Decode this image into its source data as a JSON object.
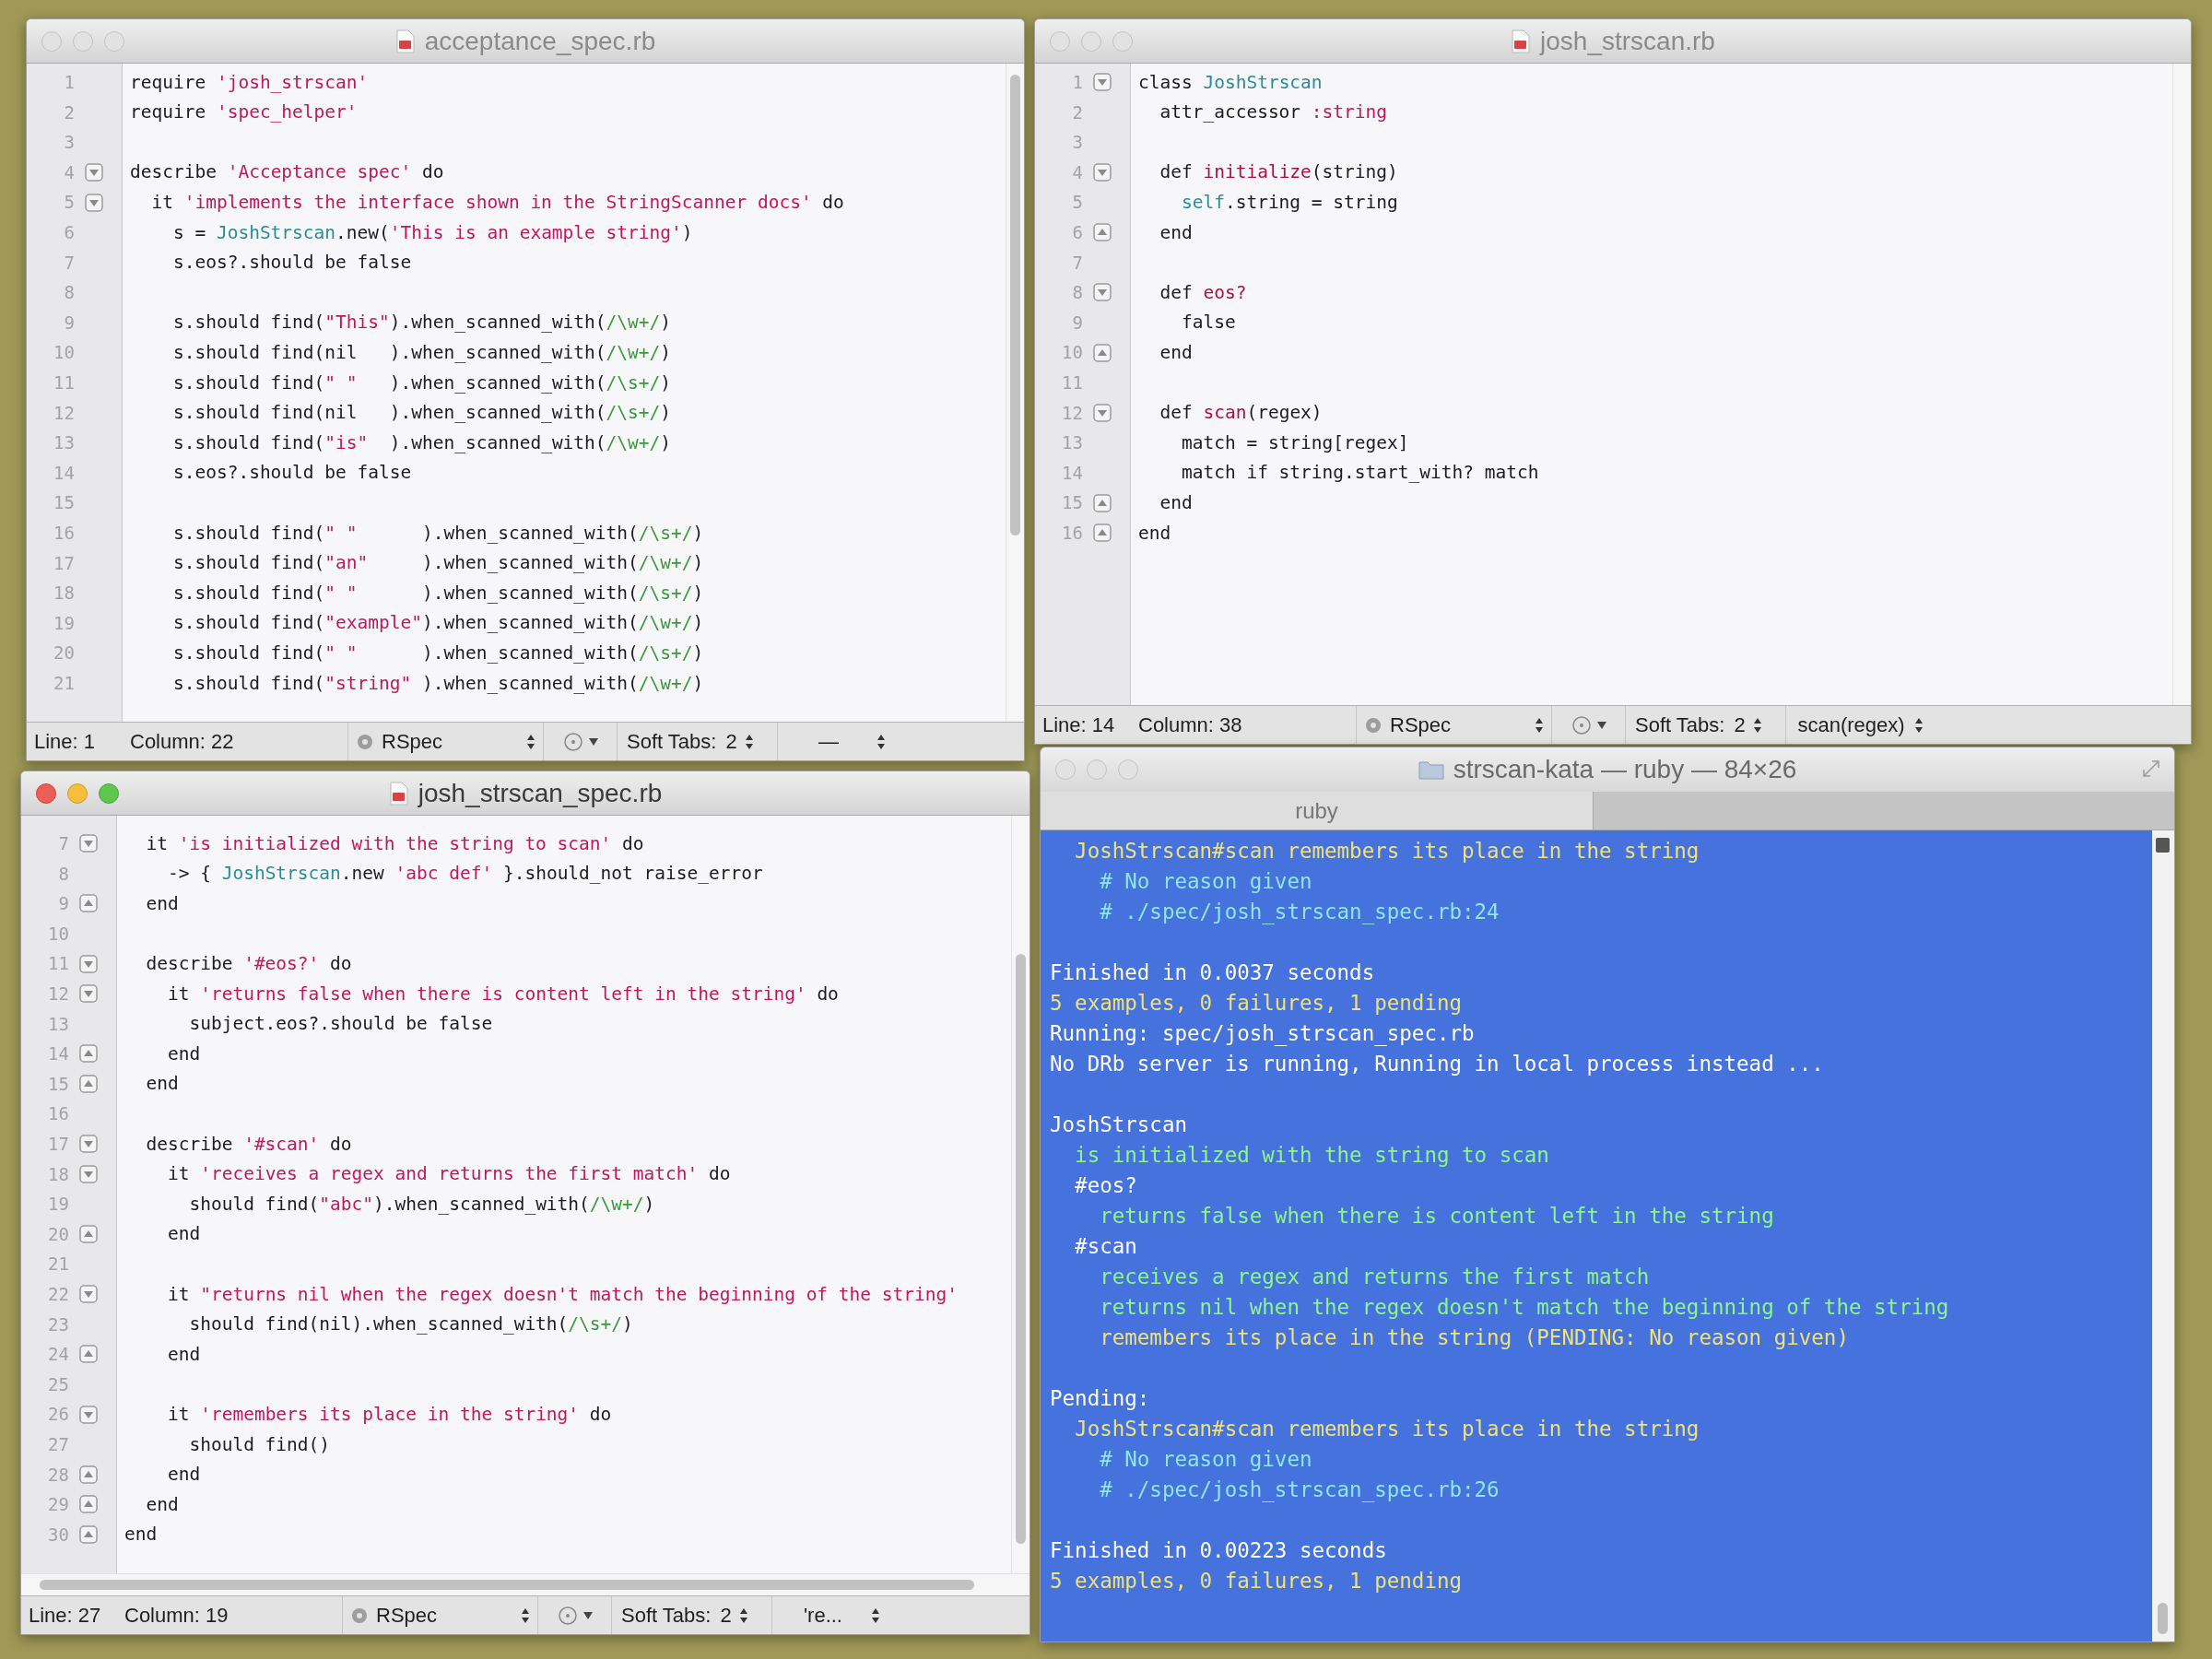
{
  "editors": [
    {
      "title": "acceptance_spec.rb",
      "active": false,
      "lines": [
        {
          "number": "1",
          "kind": "plain",
          "segments": [
            {
              "text": "require ",
              "kind": "plain"
            },
            {
              "text": "'josh_strscan'",
              "kind": "string"
            }
          ]
        },
        {
          "number": "2",
          "kind": "plain",
          "segments": [
            {
              "text": "require ",
              "kind": "plain"
            },
            {
              "text": "'spec_helper'",
              "kind": "string"
            }
          ]
        },
        {
          "number": "3",
          "kind": "plain"
        },
        {
          "number": "4",
          "kind": "opens",
          "segments": [
            {
              "text": "describe ",
              "kind": "plain"
            },
            {
              "text": "'Acceptance spec'",
              "kind": "string"
            },
            {
              "text": " do",
              "kind": "plain"
            }
          ]
        },
        {
          "number": "5",
          "kind": "opens",
          "segments": [
            {
              "text": "  it ",
              "kind": "plain"
            },
            {
              "text": "'implements the interface shown in the StringScanner docs'",
              "kind": "string"
            },
            {
              "text": " do",
              "kind": "plain"
            }
          ]
        },
        {
          "number": "6",
          "kind": "plain",
          "segments": [
            {
              "text": "    s = ",
              "kind": "plain"
            },
            {
              "text": "JoshStrscan",
              "kind": "constant"
            },
            {
              "text": ".new(",
              "kind": "plain"
            },
            {
              "text": "'This is an example string'",
              "kind": "string"
            },
            {
              "text": ")",
              "kind": "plain"
            }
          ]
        },
        {
          "number": "7",
          "kind": "plain",
          "segments": [
            {
              "text": "    s.eos?.should be false",
              "kind": "plain"
            }
          ]
        },
        {
          "number": "8",
          "kind": "plain"
        },
        {
          "number": "9",
          "kind": "plain",
          "segments": [
            {
              "text": "    s.should find(",
              "kind": "plain"
            },
            {
              "text": "\"This\"",
              "kind": "string"
            },
            {
              "text": ").when_scanned_with(",
              "kind": "plain"
            },
            {
              "text": "/\\w+/",
              "kind": "regex"
            },
            {
              "text": ")",
              "kind": "plain"
            }
          ]
        },
        {
          "number": "10",
          "kind": "plain",
          "segments": [
            {
              "text": "    s.should find(nil   ).when_scanned_with(",
              "kind": "plain"
            },
            {
              "text": "/\\w+/",
              "kind": "regex"
            },
            {
              "text": ")",
              "kind": "plain"
            }
          ]
        },
        {
          "number": "11",
          "kind": "plain",
          "segments": [
            {
              "text": "    s.should find(",
              "kind": "plain"
            },
            {
              "text": "\" \"",
              "kind": "string"
            },
            {
              "text": "   ).when_scanned_with(",
              "kind": "plain"
            },
            {
              "text": "/\\s+/",
              "kind": "regex"
            },
            {
              "text": ")",
              "kind": "plain"
            }
          ]
        },
        {
          "number": "12",
          "kind": "plain",
          "segments": [
            {
              "text": "    s.should find(nil   ).when_scanned_with(",
              "kind": "plain"
            },
            {
              "text": "/\\s+/",
              "kind": "regex"
            },
            {
              "text": ")",
              "kind": "plain"
            }
          ]
        },
        {
          "number": "13",
          "kind": "plain",
          "segments": [
            {
              "text": "    s.should find(",
              "kind": "plain"
            },
            {
              "text": "\"is\"",
              "kind": "string"
            },
            {
              "text": "  ).when_scanned_with(",
              "kind": "plain"
            },
            {
              "text": "/\\w+/",
              "kind": "regex"
            },
            {
              "text": ")",
              "kind": "plain"
            }
          ]
        },
        {
          "number": "14",
          "kind": "plain",
          "segments": [
            {
              "text": "    s.eos?.should be false",
              "kind": "plain"
            }
          ]
        },
        {
          "number": "15",
          "kind": "plain"
        },
        {
          "number": "16",
          "kind": "plain",
          "segments": [
            {
              "text": "    s.should find(",
              "kind": "plain"
            },
            {
              "text": "\" \"",
              "kind": "string"
            },
            {
              "text": "      ).when_scanned_with(",
              "kind": "plain"
            },
            {
              "text": "/\\s+/",
              "kind": "regex"
            },
            {
              "text": ")",
              "kind": "plain"
            }
          ]
        },
        {
          "number": "17",
          "kind": "plain",
          "segments": [
            {
              "text": "    s.should find(",
              "kind": "plain"
            },
            {
              "text": "\"an\"",
              "kind": "string"
            },
            {
              "text": "     ).when_scanned_with(",
              "kind": "plain"
            },
            {
              "text": "/\\w+/",
              "kind": "regex"
            },
            {
              "text": ")",
              "kind": "plain"
            }
          ]
        },
        {
          "number": "18",
          "kind": "plain",
          "segments": [
            {
              "text": "    s.should find(",
              "kind": "plain"
            },
            {
              "text": "\" \"",
              "kind": "string"
            },
            {
              "text": "      ).when_scanned_with(",
              "kind": "plain"
            },
            {
              "text": "/\\s+/",
              "kind": "regex"
            },
            {
              "text": ")",
              "kind": "plain"
            }
          ]
        },
        {
          "number": "19",
          "kind": "plain",
          "segments": [
            {
              "text": "    s.should find(",
              "kind": "plain"
            },
            {
              "text": "\"example\"",
              "kind": "string"
            },
            {
              "text": ").when_scanned_with(",
              "kind": "plain"
            },
            {
              "text": "/\\w+/",
              "kind": "regex"
            },
            {
              "text": ")",
              "kind": "plain"
            }
          ]
        },
        {
          "number": "20",
          "kind": "plain",
          "segments": [
            {
              "text": "    s.should find(",
              "kind": "plain"
            },
            {
              "text": "\" \"",
              "kind": "string"
            },
            {
              "text": "      ).when_scanned_with(",
              "kind": "plain"
            },
            {
              "text": "/\\s+/",
              "kind": "regex"
            },
            {
              "text": ")",
              "kind": "plain"
            }
          ]
        },
        {
          "number": "21",
          "kind": "plain",
          "segments": [
            {
              "text": "    s.should find(",
              "kind": "plain"
            },
            {
              "text": "\"string\"",
              "kind": "string"
            },
            {
              "text": " ).when_scanned_with(",
              "kind": "plain"
            },
            {
              "text": "/\\w+/",
              "kind": "regex"
            },
            {
              "text": ")",
              "kind": "plain"
            }
          ]
        }
      ],
      "status": {
        "line": "Line: 1",
        "column": "Column: 22",
        "grammar": "RSpec",
        "tabs_label": "Soft Tabs:",
        "tab_size": "2",
        "symbol": "—"
      }
    },
    {
      "title": "josh_strscan.rb",
      "active": false,
      "lines": [
        {
          "number": "1",
          "kind": "opens",
          "segments": [
            {
              "text": "class ",
              "kind": "plain"
            },
            {
              "text": "JoshStrscan",
              "kind": "constant"
            }
          ]
        },
        {
          "number": "2",
          "kind": "plain",
          "segments": [
            {
              "text": "  attr_accessor ",
              "kind": "plain"
            },
            {
              "text": ":string",
              "kind": "string"
            }
          ]
        },
        {
          "number": "3",
          "kind": "plain"
        },
        {
          "number": "4",
          "kind": "opens",
          "segments": [
            {
              "text": "  def ",
              "kind": "plain"
            },
            {
              "text": "initialize",
              "kind": "method"
            },
            {
              "text": "(string)",
              "kind": "plain"
            }
          ]
        },
        {
          "number": "5",
          "kind": "plain",
          "segments": [
            {
              "text": "    self",
              "kind": "constant"
            },
            {
              "text": ".string = string",
              "kind": "plain"
            }
          ]
        },
        {
          "number": "6",
          "kind": "closes",
          "segments": [
            {
              "text": "  end",
              "kind": "plain"
            }
          ]
        },
        {
          "number": "7",
          "kind": "plain"
        },
        {
          "number": "8",
          "kind": "opens",
          "segments": [
            {
              "text": "  def ",
              "kind": "plain"
            },
            {
              "text": "eos?",
              "kind": "method"
            }
          ]
        },
        {
          "number": "9",
          "kind": "plain",
          "segments": [
            {
              "text": "    false",
              "kind": "plain"
            }
          ]
        },
        {
          "number": "10",
          "kind": "closes",
          "segments": [
            {
              "text": "  end",
              "kind": "plain"
            }
          ]
        },
        {
          "number": "11",
          "kind": "plain"
        },
        {
          "number": "12",
          "kind": "opens",
          "segments": [
            {
              "text": "  def ",
              "kind": "plain"
            },
            {
              "text": "scan",
              "kind": "method"
            },
            {
              "text": "(regex)",
              "kind": "plain"
            }
          ]
        },
        {
          "number": "13",
          "kind": "plain",
          "segments": [
            {
              "text": "    match = string[regex]",
              "kind": "plain"
            }
          ]
        },
        {
          "number": "14",
          "kind": "plain",
          "segments": [
            {
              "text": "    match if string.start_with? match",
              "kind": "plain"
            }
          ]
        },
        {
          "number": "15",
          "kind": "closes",
          "segments": [
            {
              "text": "  end",
              "kind": "plain"
            }
          ]
        },
        {
          "number": "16",
          "kind": "closes",
          "segments": [
            {
              "text": "end",
              "kind": "plain"
            }
          ]
        }
      ],
      "status": {
        "line": "Line: 14",
        "column": "Column: 38",
        "grammar": "RSpec",
        "tabs_label": "Soft Tabs:",
        "tab_size": "2",
        "symbol": "scan(regex)"
      }
    },
    {
      "title": "josh_strscan_spec.rb",
      "active": true,
      "lines": [
        {
          "number": "7",
          "kind": "opens",
          "segments": [
            {
              "text": "  it ",
              "kind": "plain"
            },
            {
              "text": "'is initialized with the string to scan'",
              "kind": "string"
            },
            {
              "text": " do",
              "kind": "plain"
            }
          ]
        },
        {
          "number": "8",
          "kind": "plain",
          "segments": [
            {
              "text": "    -> { ",
              "kind": "plain"
            },
            {
              "text": "JoshStrscan",
              "kind": "constant"
            },
            {
              "text": ".new ",
              "kind": "plain"
            },
            {
              "text": "'abc def'",
              "kind": "string"
            },
            {
              "text": " }.should_not raise_error",
              "kind": "plain"
            }
          ]
        },
        {
          "number": "9",
          "kind": "closes",
          "segments": [
            {
              "text": "  end",
              "kind": "plain"
            }
          ]
        },
        {
          "number": "10",
          "kind": "plain"
        },
        {
          "number": "11",
          "kind": "opens",
          "segments": [
            {
              "text": "  describe ",
              "kind": "plain"
            },
            {
              "text": "'#eos?'",
              "kind": "string"
            },
            {
              "text": " do",
              "kind": "plain"
            }
          ]
        },
        {
          "number": "12",
          "kind": "opens",
          "segments": [
            {
              "text": "    it ",
              "kind": "plain"
            },
            {
              "text": "'returns false when there is content left in the string'",
              "kind": "string"
            },
            {
              "text": " do",
              "kind": "plain"
            }
          ]
        },
        {
          "number": "13",
          "kind": "plain",
          "segments": [
            {
              "text": "      subject.eos?.should be false",
              "kind": "plain"
            }
          ]
        },
        {
          "number": "14",
          "kind": "closes",
          "segments": [
            {
              "text": "    end",
              "kind": "plain"
            }
          ]
        },
        {
          "number": "15",
          "kind": "closes",
          "segments": [
            {
              "text": "  end",
              "kind": "plain"
            }
          ]
        },
        {
          "number": "16",
          "kind": "plain"
        },
        {
          "number": "17",
          "kind": "opens",
          "segments": [
            {
              "text": "  describe ",
              "kind": "plain"
            },
            {
              "text": "'#scan'",
              "kind": "string"
            },
            {
              "text": " do",
              "kind": "plain"
            }
          ]
        },
        {
          "number": "18",
          "kind": "opens",
          "segments": [
            {
              "text": "    it ",
              "kind": "plain"
            },
            {
              "text": "'receives a regex and returns the first match'",
              "kind": "string"
            },
            {
              "text": " do",
              "kind": "plain"
            }
          ]
        },
        {
          "number": "19",
          "kind": "plain",
          "segments": [
            {
              "text": "      should find(",
              "kind": "plain"
            },
            {
              "text": "\"abc\"",
              "kind": "string"
            },
            {
              "text": ").when_scanned_with(",
              "kind": "plain"
            },
            {
              "text": "/\\w+/",
              "kind": "regex"
            },
            {
              "text": ")",
              "kind": "plain"
            }
          ]
        },
        {
          "number": "20",
          "kind": "closes",
          "segments": [
            {
              "text": "    end",
              "kind": "plain"
            }
          ]
        },
        {
          "number": "21",
          "kind": "plain"
        },
        {
          "number": "22",
          "kind": "opens",
          "segments": [
            {
              "text": "    it ",
              "kind": "plain"
            },
            {
              "text": "\"returns nil when the regex doesn't match the beginning of the string'",
              "kind": "string"
            }
          ]
        },
        {
          "number": "23",
          "kind": "plain",
          "segments": [
            {
              "text": "      should find(nil).when_scanned_with(",
              "kind": "plain"
            },
            {
              "text": "/\\s+/",
              "kind": "regex"
            },
            {
              "text": ")",
              "kind": "plain"
            }
          ]
        },
        {
          "number": "24",
          "kind": "closes",
          "segments": [
            {
              "text": "    end",
              "kind": "plain"
            }
          ]
        },
        {
          "number": "25",
          "kind": "plain"
        },
        {
          "number": "26",
          "kind": "opens",
          "segments": [
            {
              "text": "    it ",
              "kind": "plain"
            },
            {
              "text": "'remembers its place in the string'",
              "kind": "string"
            },
            {
              "text": " do",
              "kind": "plain"
            }
          ]
        },
        {
          "number": "27",
          "kind": "plain",
          "segments": [
            {
              "text": "      should find()",
              "kind": "plain"
            }
          ]
        },
        {
          "number": "28",
          "kind": "closes",
          "segments": [
            {
              "text": "    end",
              "kind": "plain"
            }
          ]
        },
        {
          "number": "29",
          "kind": "closes",
          "segments": [
            {
              "text": "  end",
              "kind": "plain"
            }
          ]
        },
        {
          "number": "30",
          "kind": "closes",
          "segments": [
            {
              "text": "end",
              "kind": "plain"
            }
          ]
        }
      ],
      "status": {
        "line": "Line: 27",
        "column": "Column: 19",
        "grammar": "RSpec",
        "tabs_label": "Soft Tabs:",
        "tab_size": "2",
        "symbol": "'re..."
      }
    }
  ],
  "terminal": {
    "title": "strscan-kata — ruby — 84×26",
    "active": false,
    "tabs": [
      {
        "label": "ruby",
        "selected": true
      }
    ],
    "lines": [
      {
        "kind": "pending",
        "text": "  JoshStrscan#scan remembers its place in the string"
      },
      {
        "kind": "comment",
        "text": "    # No reason given"
      },
      {
        "kind": "comment",
        "text": "    # ./spec/josh_strscan_spec.rb:24"
      },
      {
        "kind": "blank"
      },
      {
        "kind": "plain",
        "text": "Finished in 0.0037 seconds"
      },
      {
        "kind": "pending",
        "text": "5 examples, 0 failures, 1 pending"
      },
      {
        "kind": "plain",
        "text": "Running: spec/josh_strscan_spec.rb"
      },
      {
        "kind": "plain",
        "text": "No DRb server is running, Running in local process instead ..."
      },
      {
        "kind": "blank"
      },
      {
        "kind": "plain",
        "text": "JoshStrscan"
      },
      {
        "kind": "pass",
        "text": "  is initialized with the string to scan"
      },
      {
        "kind": "plain",
        "text": "  #eos?"
      },
      {
        "kind": "pass",
        "text": "    returns false when there is content left in the string"
      },
      {
        "kind": "plain",
        "text": "  #scan"
      },
      {
        "kind": "pass",
        "text": "    receives a regex and returns the first match"
      },
      {
        "kind": "pass",
        "text": "    returns nil when the regex doesn't match the beginning of the string"
      },
      {
        "kind": "pending",
        "text": "    remembers its place in the string (PENDING: No reason given)"
      },
      {
        "kind": "blank"
      },
      {
        "kind": "plain",
        "text": "Pending:"
      },
      {
        "kind": "pending",
        "text": "  JoshStrscan#scan remembers its place in the string"
      },
      {
        "kind": "comment",
        "text": "    # No reason given"
      },
      {
        "kind": "comment",
        "text": "    # ./spec/josh_strscan_spec.rb:26"
      },
      {
        "kind": "blank"
      },
      {
        "kind": "plain",
        "text": "Finished in 0.00223 seconds"
      },
      {
        "kind": "pending",
        "text": "5 examples, 0 failures, 1 pending"
      }
    ]
  }
}
